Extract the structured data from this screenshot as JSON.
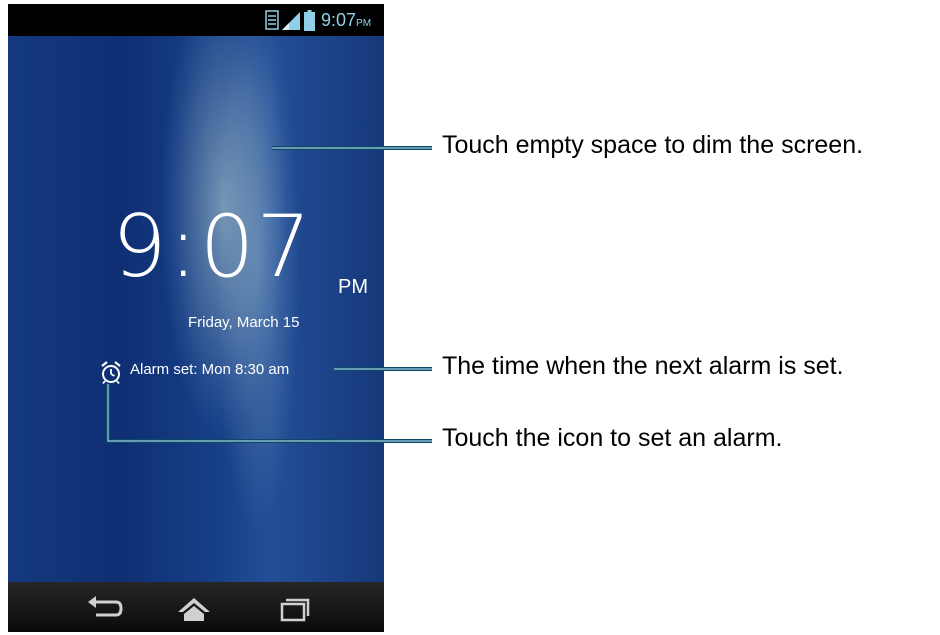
{
  "status_bar": {
    "time": "9:07",
    "ampm": "PM",
    "icons": [
      "lte-icon",
      "signal-icon",
      "battery-icon"
    ]
  },
  "clock": {
    "time": "9:07",
    "ampm": "PM",
    "date": "Friday, March 15"
  },
  "alarm": {
    "icon": "alarm-clock-icon",
    "text": "Alarm set: Mon 8:30 am"
  },
  "nav_bar": {
    "icons": [
      "back-icon",
      "home-icon",
      "recent-apps-icon"
    ]
  },
  "callouts": {
    "dim_screen": "Touch empty space to dim the screen.",
    "next_alarm": "The time when the next alarm is set.",
    "set_alarm": "Touch the icon to set an alarm."
  },
  "colors": {
    "callout_line": "#1b6e8e",
    "status_text": "#8fd0e8",
    "wallpaper": "#15397e"
  }
}
